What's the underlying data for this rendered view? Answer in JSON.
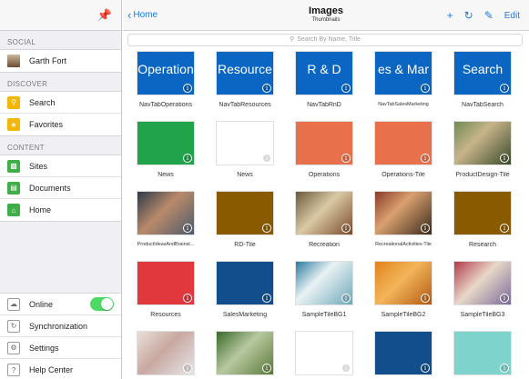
{
  "sidebar": {
    "sections": [
      {
        "title": "SOCIAL",
        "items": [
          {
            "label": "Garth Fort",
            "icon": "avatar"
          }
        ]
      },
      {
        "title": "DISCOVER",
        "items": [
          {
            "label": "Search",
            "icon": "search-icon"
          },
          {
            "label": "Favorites",
            "icon": "star-icon"
          }
        ]
      },
      {
        "title": "CONTENT",
        "items": [
          {
            "label": "Sites",
            "icon": "sites-icon"
          },
          {
            "label": "Documents",
            "icon": "document-icon"
          },
          {
            "label": "Home",
            "icon": "home-icon"
          }
        ]
      }
    ],
    "bottom": [
      {
        "label": "Online",
        "icon": "cloud-icon",
        "toggle": true
      },
      {
        "label": "Synchronization",
        "icon": "sync-icon"
      },
      {
        "label": "Settings",
        "icon": "gear-icon"
      },
      {
        "label": "Help Center",
        "icon": "help-icon"
      }
    ]
  },
  "navbar": {
    "back_label": "Home",
    "title": "Images",
    "subtitle": "Thumbnails",
    "edit_label": "Edit"
  },
  "search": {
    "placeholder": "Search By Name, Title"
  },
  "tiles": [
    {
      "caption": "NavTabOperations",
      "thumb_text": "Operation"
    },
    {
      "caption": "NavTabResources",
      "thumb_text": "Resource"
    },
    {
      "caption": "NavTabRnD",
      "thumb_text": "R & D"
    },
    {
      "caption": "NavTabSalesMarketing",
      "thumb_text": "es & Mar"
    },
    {
      "caption": "NavTabSearch",
      "thumb_text": "Search"
    },
    {
      "caption": "News"
    },
    {
      "caption": "News"
    },
    {
      "caption": "Operations"
    },
    {
      "caption": "Operations-Tile"
    },
    {
      "caption": "ProductDesign-Tile"
    },
    {
      "caption": "ProductIdeasAndBrainst..."
    },
    {
      "caption": "RD-Tile"
    },
    {
      "caption": "Recreation"
    },
    {
      "caption": "RecreationalActivities-Tile"
    },
    {
      "caption": "Research"
    },
    {
      "caption": "Resources"
    },
    {
      "caption": "SalesMarketing"
    },
    {
      "caption": "SampleTileBG1"
    },
    {
      "caption": "SampleTileBG2"
    },
    {
      "caption": "SampleTileBG3"
    },
    {
      "caption": ""
    },
    {
      "caption": ""
    },
    {
      "caption": ""
    },
    {
      "caption": ""
    },
    {
      "caption": ""
    }
  ],
  "colors": {
    "accent": "#1e7be0",
    "toggle_on": "#4cd964"
  }
}
